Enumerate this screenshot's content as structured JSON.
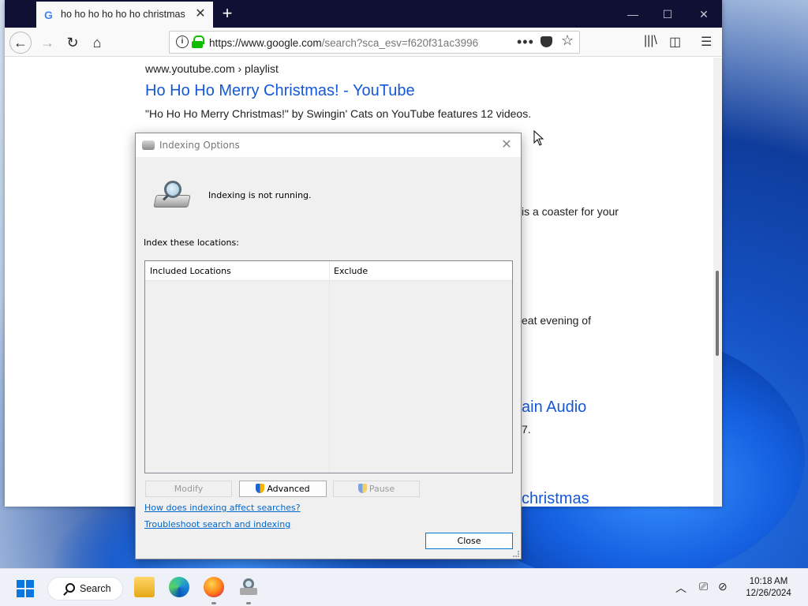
{
  "browser": {
    "tab_title": "ho ho ho ho ho ho christmas",
    "tab_favicon": "G",
    "url_main": "https://www.google.com",
    "url_rest": "/search?sca_esv=f620f31ac3996",
    "page_actions": "•••"
  },
  "results": {
    "r1_cite": "www.youtube.com › playlist",
    "r1_title": "Ho Ho Ho Merry Christmas! - YouTube",
    "r1_snippet": "\"Ho Ho Ho Merry Christmas!\" by Swingin' Cats on YouTube features 12 videos.",
    "frag1": "is a coaster for your",
    "frag2": "eat evening of",
    "frag3": "ain Audio",
    "frag4": "7.",
    "frag5": "christmas"
  },
  "dialog": {
    "title": "Indexing Options",
    "status": "Indexing is not running.",
    "locations_label": "Index these locations:",
    "col_included": "Included Locations",
    "col_exclude": "Exclude",
    "modify": "Modify",
    "advanced": "Advanced",
    "pause": "Pause",
    "link_affect": "How does indexing affect searches?",
    "link_troubleshoot": "Troubleshoot search and indexing",
    "close": "Close"
  },
  "taskbar": {
    "search_label": "Search",
    "time": "10:18 AM",
    "date": "12/26/2024"
  },
  "colors": {
    "link_blue": "#1558d6",
    "dialog_link": "#0066cc",
    "accent": "#0078d7"
  }
}
